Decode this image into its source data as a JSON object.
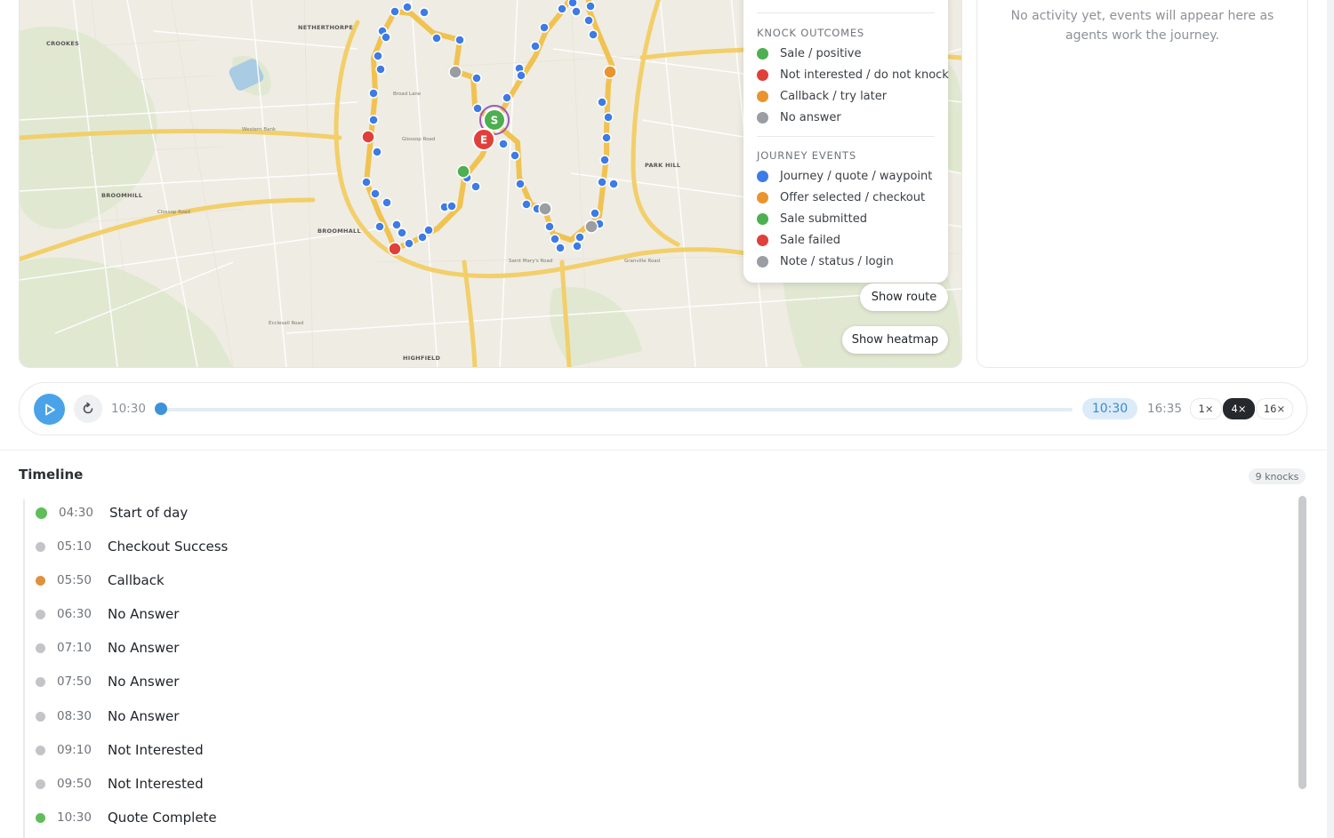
{
  "map": {
    "labels": {
      "crookes": "CROOKES",
      "netherthorpe": "NETHERTHORPE",
      "broomhill": "BROOMHILL",
      "broomhall": "BROOMHALL",
      "park_hill": "PARK HILL",
      "highfield": "HIGHFIELD"
    },
    "start_marker": "S",
    "end_marker": "E",
    "buttons": {
      "show_route": "Show route",
      "show_heatmap": "Show heatmap"
    }
  },
  "legend": {
    "knock_outcomes_title": "KNOCK OUTCOMES",
    "knock_outcomes": [
      {
        "label": "Sale / positive",
        "color": "#4caf50"
      },
      {
        "label": "Not interested / do not knock",
        "color": "#e0403a"
      },
      {
        "label": "Callback / try later",
        "color": "#e8952d"
      },
      {
        "label": "No answer",
        "color": "#9a9da2"
      }
    ],
    "journey_events_title": "JOURNEY EVENTS",
    "journey_events": [
      {
        "label": "Journey / quote / waypoint",
        "color": "#3d7be6"
      },
      {
        "label": "Offer selected / checkout",
        "color": "#e8952d"
      },
      {
        "label": "Sale submitted",
        "color": "#4caf50"
      },
      {
        "label": "Sale failed",
        "color": "#e0403a"
      },
      {
        "label": "Note / status / login",
        "color": "#9a9da2"
      }
    ]
  },
  "activity": {
    "empty_message": "No activity yet, events will appear here as agents work the journey."
  },
  "player": {
    "start_time": "10:30",
    "current_time": "10:30",
    "end_time": "16:35",
    "progress": 0.0,
    "speeds": [
      "1×",
      "4×",
      "16×"
    ],
    "active_speed": "4×"
  },
  "timeline": {
    "title": "Timeline",
    "count_badge": "9 knocks",
    "items": [
      {
        "time": "04:30",
        "label": "Start of day",
        "color": "#5fbe5a"
      },
      {
        "time": "05:10",
        "label": "Checkout Success",
        "color": "#c2c4c7"
      },
      {
        "time": "05:50",
        "label": "Callback",
        "color": "#e0913f"
      },
      {
        "time": "06:30",
        "label": "No Answer",
        "color": "#c2c4c7"
      },
      {
        "time": "07:10",
        "label": "No Answer",
        "color": "#c2c4c7"
      },
      {
        "time": "07:50",
        "label": "No Answer",
        "color": "#c2c4c7"
      },
      {
        "time": "08:30",
        "label": "No Answer",
        "color": "#c2c4c7"
      },
      {
        "time": "09:10",
        "label": "Not Interested",
        "color": "#c2c4c7"
      },
      {
        "time": "09:50",
        "label": "Not Interested",
        "color": "#c2c4c7"
      },
      {
        "time": "10:30",
        "label": "Quote Complete",
        "color": "#5fbe5a"
      }
    ]
  }
}
